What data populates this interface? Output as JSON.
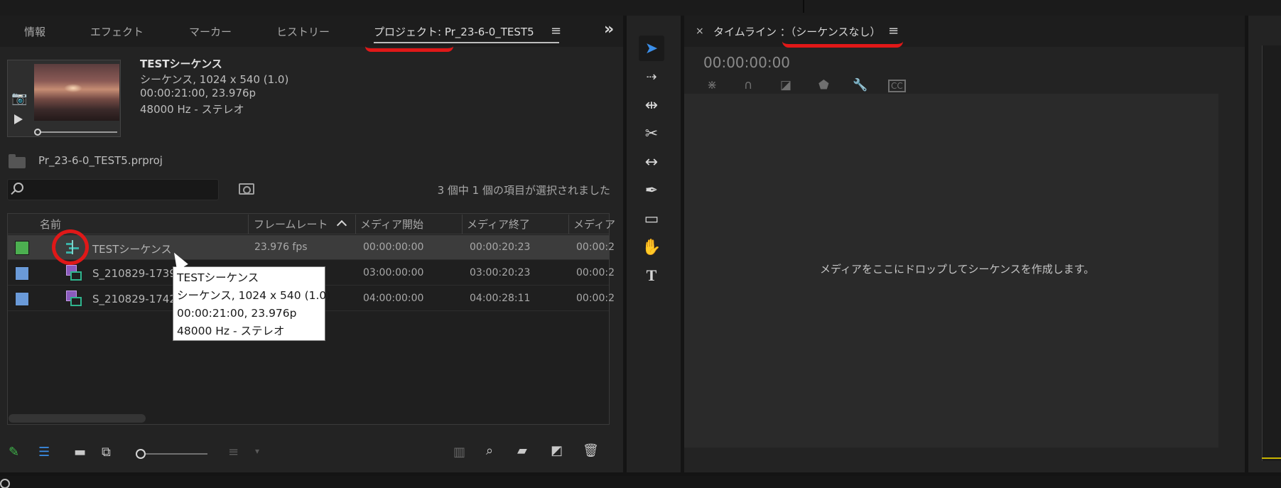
{
  "project_panel": {
    "tabs": [
      "情報",
      "エフェクト",
      "マーカー",
      "ヒストリー",
      "プロジェクト: Pr_23-6-0_TEST5"
    ],
    "preview": {
      "title": "TESTシーケンス",
      "line1": "シーケンス, 1024 x 540 (1.0)",
      "line2": "00:00:21:00, 23.976p",
      "line3": "48000 Hz - ステレオ"
    },
    "project_file": "Pr_23-6-0_TEST5.prproj",
    "search_placeholder": "",
    "selection_count": "3 個中 1 個の項目が選択されました",
    "columns": [
      "名前",
      "フレームレート",
      "メディア開始",
      "メディア終了",
      "メディア"
    ],
    "rows": [
      {
        "name": "TESTシーケンス",
        "framerate": "23.976 fps",
        "start": "00:00:00:00",
        "end": "00:00:20:23",
        "extra": "00:00:2",
        "color": "#4caf50",
        "icon": "sequence-icon"
      },
      {
        "name": "S_210829-1739",
        "framerate": "",
        "start": "03:00:00:00",
        "end": "03:00:20:23",
        "extra": "00:00:2",
        "color": "#6a9ad8",
        "icon": "clip-icon"
      },
      {
        "name": "S_210829-1742",
        "framerate": "",
        "start": "04:00:00:00",
        "end": "04:00:28:11",
        "extra": "00:00:2",
        "color": "#6a9ad8",
        "icon": "clip-icon"
      }
    ],
    "tooltip": {
      "line1": "TESTシーケンス",
      "line2": "シーケンス, 1024 x 540 (1.0)",
      "line3": "00:00:21:00, 23.976p",
      "line4": "48000 Hz - ステレオ"
    }
  },
  "timeline_panel": {
    "title": "タイムライン ：（シーケンスなし）",
    "timecode": "00:00:00:00",
    "drop_message": "メディアをここにドロップしてシーケンスを作成します。"
  },
  "colors": {
    "accent_blue": "#3b8ee8",
    "annotation_red": "#e01818",
    "label_green": "#4caf50",
    "label_blue": "#6a9ad8"
  }
}
